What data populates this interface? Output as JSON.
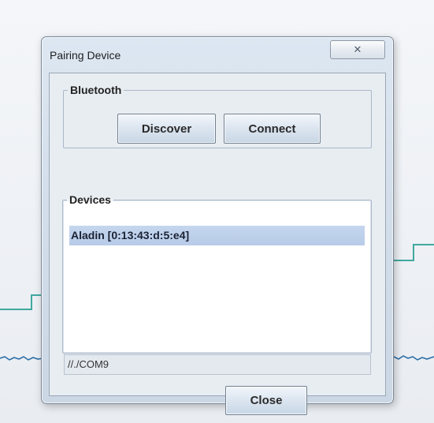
{
  "window": {
    "title": "Pairing Device",
    "close_glyph": "✕"
  },
  "bluetooth": {
    "legend": "Bluetooth",
    "discover_label": "Discover",
    "connect_label": "Connect"
  },
  "devices": {
    "legend": "Devices",
    "items": [
      {
        "label": "Aladin [0:13:43:d:5:e4]",
        "selected": true
      }
    ]
  },
  "status": {
    "text": "//./COM9"
  },
  "footer": {
    "close_label": "Close"
  },
  "colors": {
    "selection": "#bcd0ea",
    "signal_line": "#3fa9a0",
    "noise_line": "#2c6fa8"
  },
  "icons": [
    "close-icon"
  ]
}
